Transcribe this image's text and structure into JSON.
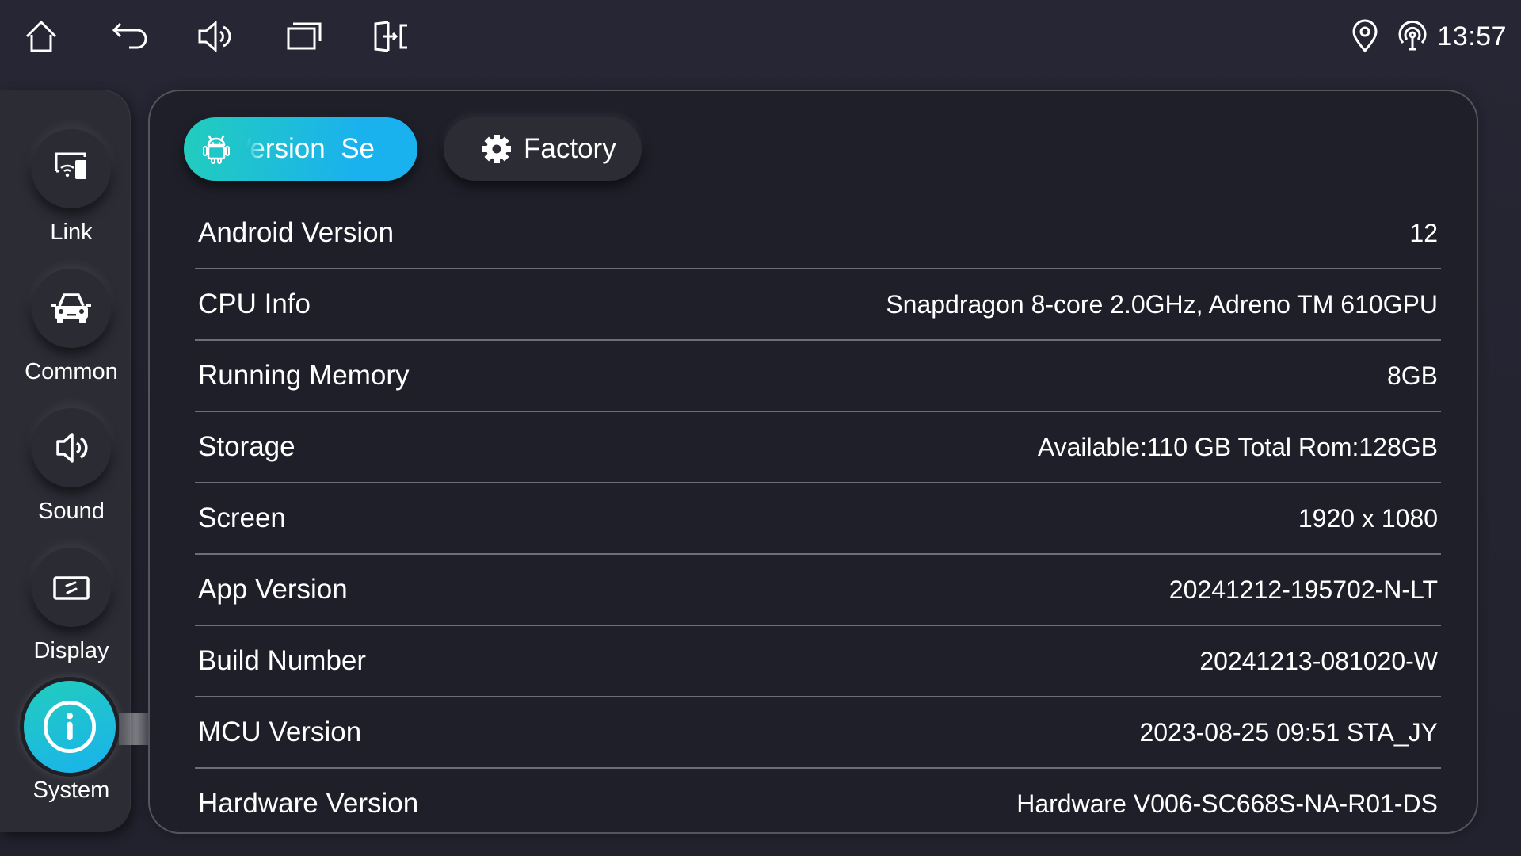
{
  "status_bar": {
    "nav_icons": [
      {
        "name": "home-icon",
        "label": "Home"
      },
      {
        "name": "back-icon",
        "label": "Back"
      },
      {
        "name": "volume-icon",
        "label": "Volume"
      },
      {
        "name": "recent-apps-icon",
        "label": "Recent apps"
      },
      {
        "name": "split-screen-icon",
        "label": "Exit / split"
      }
    ],
    "status_icons": [
      "location-icon",
      "hotspot-icon"
    ],
    "time": "13:57"
  },
  "sidebar": {
    "items": [
      {
        "label": "Link",
        "icon": "screen-link-icon",
        "active": false
      },
      {
        "label": "Common",
        "icon": "car-icon",
        "active": false
      },
      {
        "label": "Sound",
        "icon": "speaker-icon",
        "active": false
      },
      {
        "label": "Display",
        "icon": "display-icon",
        "active": false
      },
      {
        "label": "System",
        "icon": "info-icon",
        "active": true
      }
    ]
  },
  "tabs": [
    {
      "label": "Version  Se",
      "icon": "android-icon",
      "active": true
    },
    {
      "label": "Factory",
      "icon": "gear-icon",
      "active": false
    }
  ],
  "info_rows": [
    {
      "label": "Android Version",
      "value": "12"
    },
    {
      "label": "CPU Info",
      "value": "Snapdragon 8-core 2.0GHz, Adreno TM 610GPU"
    },
    {
      "label": "Running Memory",
      "value": "8GB"
    },
    {
      "label": "Storage",
      "value": "Available:110 GB Total Rom:128GB"
    },
    {
      "label": "Screen",
      "value": "1920 x 1080"
    },
    {
      "label": "App Version",
      "value": "20241212-195702-N-LT"
    },
    {
      "label": "Build Number",
      "value": "20241213-081020-W"
    },
    {
      "label": "MCU Version",
      "value": "2023-08-25 09:51 STA_JY"
    },
    {
      "label": "Hardware Version",
      "value": "Hardware V006-SC668S-NA-R01-DS"
    }
  ],
  "colors": {
    "accent_start": "#22cdbc",
    "accent_end": "#1ab1ef",
    "background": "#232330",
    "panel": "#1f1f2a"
  }
}
